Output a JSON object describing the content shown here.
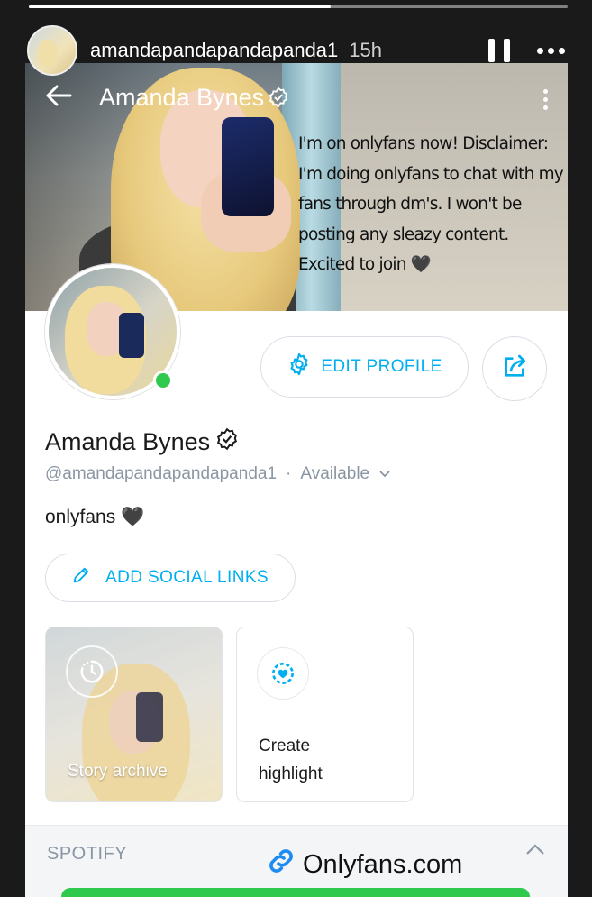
{
  "story": {
    "username": "amandapandapandapanda1",
    "time": "15h",
    "progress": 0.56
  },
  "profile": {
    "header_title": "Amanda Bynes",
    "overlay_text": "I'm on onlyfans now! Disclaimer:\nI'm doing onlyfans to chat with my\nfans through dm's. I won't be\nposting any sleazy content.\nExcited to join 🖤",
    "edit_profile_label": "EDIT PROFILE",
    "name": "Amanda Bynes",
    "handle": "@amandapandapandapanda1",
    "separator": "·",
    "status": "Available",
    "bio": "onlyfans 🖤",
    "add_social_label": "ADD SOCIAL LINKS",
    "highlights": [
      {
        "label": "Story archive"
      },
      {
        "label": "Create\nhighlight"
      }
    ],
    "section_label": "SPOTIFY"
  },
  "link_sticker": {
    "text": "Onlyfans.com"
  },
  "colors": {
    "accent": "#00aff0",
    "online": "#2ec94d",
    "muted": "#8a96a3"
  },
  "icons": [
    "back-arrow-icon",
    "verified-badge-icon",
    "kebab-menu-icon",
    "gear-icon",
    "share-icon",
    "pencil-icon",
    "clock-history-icon",
    "highlight-heart-icon",
    "chevron-up-icon",
    "link-icon",
    "pause-icon",
    "more-dots-icon",
    "chevron-down-icon"
  ]
}
